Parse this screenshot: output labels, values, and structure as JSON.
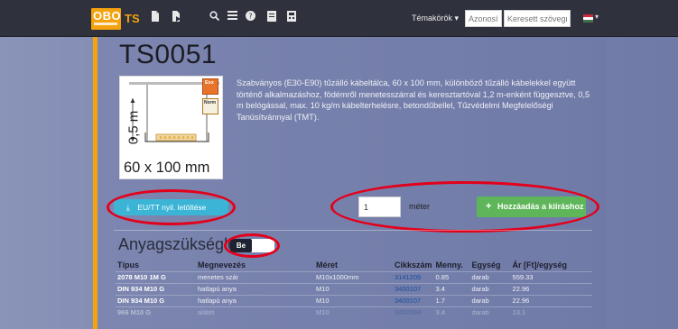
{
  "navbar": {
    "logo_text": "OBO",
    "app_name": "TS",
    "icons": [
      "document-icon",
      "document-arrow-icon",
      "search-icon",
      "list-icon",
      "help-icon",
      "file-icon",
      "calculator-icon"
    ],
    "topics_label": "Témakörök ▾",
    "id_placeholder": "Azonosító",
    "search_placeholder": "Keresett szövegrész",
    "language_flag": "hungary-flag",
    "flag_colors": [
      "#cd2a3e",
      "#ffffff",
      "#436f4d"
    ]
  },
  "product": {
    "code": "TS0051",
    "image_labels": {
      "dimension_vertical": "0,5 m",
      "dimension_bottom": "60 x 100 mm",
      "badge_exx": "Exx",
      "badge_norm": "Norm"
    },
    "description": "Szabványos (E30-E90) tűzálló kábeltálca, 60 x 100 mm, különböző tűzálló kábelekkel együtt történő alkalmazáshoz, födémről menetesszárral és keresztartóval 1,2 m-enként függesztve, 0,5 m belógással, max. 10 kg/m kábelterhelésre, betondűbellel, Tűzvédelmi Megfelelőségi Tanúsítvánnyal (TMT)."
  },
  "actions": {
    "download_label": "EU/TT nyil. letöltése",
    "quantity_value": "1",
    "unit_label": "méter",
    "add_label": "Hozzáadás a kiíráshoz"
  },
  "materials": {
    "title": "Anyagszükséglet",
    "toggle_label": "Be",
    "columns": [
      "Típus",
      "Megnevezés",
      "Méret",
      "Cikkszám",
      "Menny.",
      "Egység",
      "Ár [Ft]/egység"
    ],
    "rows": [
      [
        "2078 M10 1M G",
        "menetes szár",
        "M10x1000mm",
        "3141209",
        "0.85",
        "darab",
        "559.33"
      ],
      [
        "DIN 934 M10 G",
        "hatlapú anya",
        "M10",
        "3400107",
        "3.4",
        "darab",
        "22.96"
      ],
      [
        "DIN 934 M10 G",
        "hatlapú anya",
        "M10",
        "3400107",
        "1.7",
        "darab",
        "22.96"
      ],
      [
        "966 M10 G",
        "alátét",
        "M10",
        "3402094",
        "3.4",
        "darab",
        "13.1"
      ]
    ]
  },
  "colors": {
    "accent_orange": "#f4a20e",
    "highlight_red": "#e3001b",
    "download_blue": "#3cb4d6",
    "add_green": "#5fb65a"
  }
}
